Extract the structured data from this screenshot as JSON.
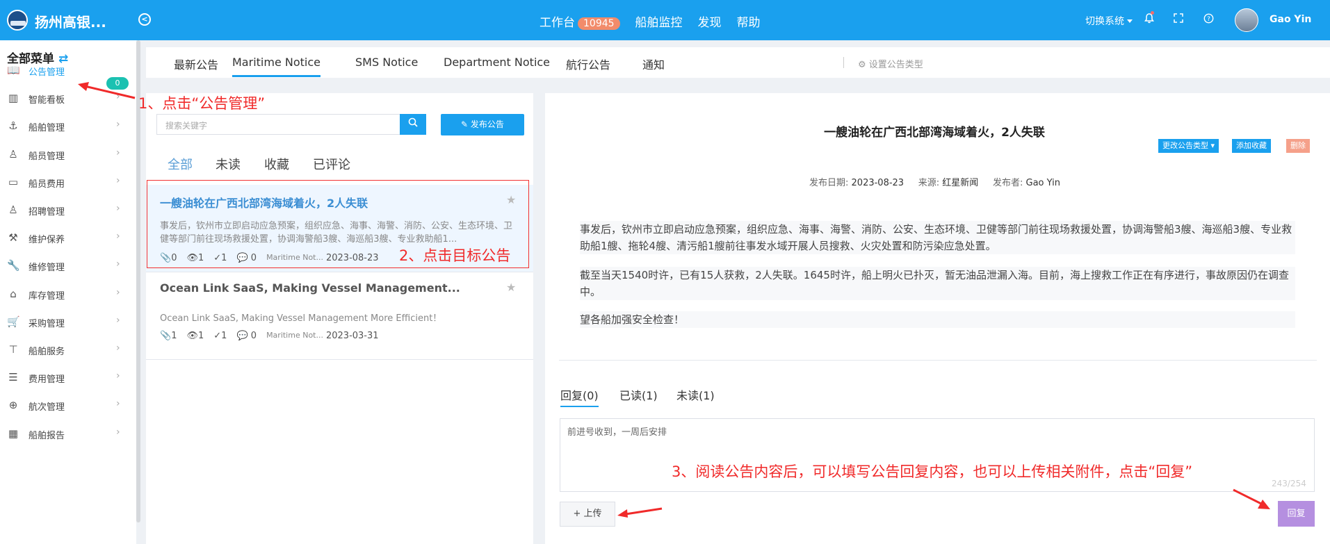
{
  "header": {
    "app_title": "扬州高银...",
    "nav": [
      {
        "label": "工作台",
        "badge": "10945"
      },
      {
        "label": "船舶监控"
      },
      {
        "label": "发现"
      },
      {
        "label": "帮助"
      }
    ],
    "switch_system": "切换系统",
    "user_name": "Gao Yin"
  },
  "sidebar": {
    "title": "全部菜单",
    "badge": "0",
    "items": [
      {
        "label": "公告管理",
        "icon": "book-icon"
      },
      {
        "label": "智能看板",
        "icon": "bar-chart-icon"
      },
      {
        "label": "船舶管理",
        "icon": "anchor-icon"
      },
      {
        "label": "船员管理",
        "icon": "person-icon"
      },
      {
        "label": "船员费用",
        "icon": "wallet-icon"
      },
      {
        "label": "招聘管理",
        "icon": "recruit-icon"
      },
      {
        "label": "维护保养",
        "icon": "tool-icon"
      },
      {
        "label": "维修管理",
        "icon": "wrench-icon"
      },
      {
        "label": "库存管理",
        "icon": "warehouse-icon"
      },
      {
        "label": "采购管理",
        "icon": "cart-icon"
      },
      {
        "label": "船舶服务",
        "icon": "roller-icon"
      },
      {
        "label": "费用管理",
        "icon": "coins-icon"
      },
      {
        "label": "航次管理",
        "icon": "globe-icon"
      },
      {
        "label": "船舶报告",
        "icon": "calendar-icon"
      }
    ]
  },
  "tabs": [
    "最新公告",
    "Maritime Notice",
    "SMS Notice",
    "Department Notice",
    "航行公告",
    "通知"
  ],
  "tab_settings": "设置公告类型",
  "list": {
    "search_placeholder": "搜索关键字",
    "publish_label": "发布公告",
    "filters": [
      "全部",
      "未读",
      "收藏",
      "已评论"
    ],
    "notices": [
      {
        "title": "一艘油轮在广西北部湾海域着火，2人失联",
        "summary": "事发后，钦州市立即启动应急预案，组织应急、海事、海警、消防、公安、生态环境、卫健等部门前往现场救援处置，协调海警船3艘、海巡船3艘、专业救助船1...",
        "attach": "0",
        "views": "1",
        "read": "1",
        "comments": "0",
        "type": "Maritime Not...",
        "date": "2023-08-23"
      },
      {
        "title": "Ocean Link SaaS, Making Vessel Management...",
        "summary": "Ocean Link SaaS, Making Vessel Management More Efficient！",
        "attach": "1",
        "views": "1",
        "read": "1",
        "comments": "0",
        "type": "Maritime Not...",
        "date": "2023-03-31"
      }
    ]
  },
  "detail": {
    "title": "一艘油轮在广西北部湾海域着火，2人失联",
    "buttons": {
      "change_type": "更改公告类型",
      "favorite": "添加收藏",
      "delete": "删除"
    },
    "date_label": "发布日期:",
    "date": "2023-08-23",
    "source_label": "来源:",
    "source": "红星新闻",
    "publisher_label": "发布者:",
    "publisher": "Gao Yin",
    "paragraphs": [
      "事发后，钦州市立即启动应急预案，组织应急、海事、海警、消防、公安、生态环境、卫健等部门前往现场救援处置，协调海警船3艘、海巡船3艘、专业救助船1艘、拖轮4艘、清污船1艘前往事发水域开展人员搜救、火灾处置和防污染应急处置。",
      "截至当天1540时许，已有15人获救，2人失联。1645时许，船上明火已扑灭，暂无油品泄漏入海。目前，海上搜救工作正在有序进行，事故原因仍在调查中。",
      "望各船加强安全检查！"
    ],
    "reply_tabs": [
      "回复(0)",
      "已读(1)",
      "未读(1)"
    ],
    "reply_text": "前进号收到，一周后安排",
    "counter": "243/254",
    "upload_label": "+ 上传",
    "reply_label": "回复"
  },
  "annotations": {
    "step1": "1、点击“公告管理”",
    "step2": "2、点击目标公告",
    "step3": "3、阅读公告内容后，可以填写公告回复内容，也可以上传相关附件，点击“回复”"
  },
  "colors": {
    "primary": "#1aa0ee",
    "annotation": "#f02a2a",
    "badge": "#f28b6a",
    "reply_button": "#b58fe0",
    "delete": "#f5a08a"
  }
}
